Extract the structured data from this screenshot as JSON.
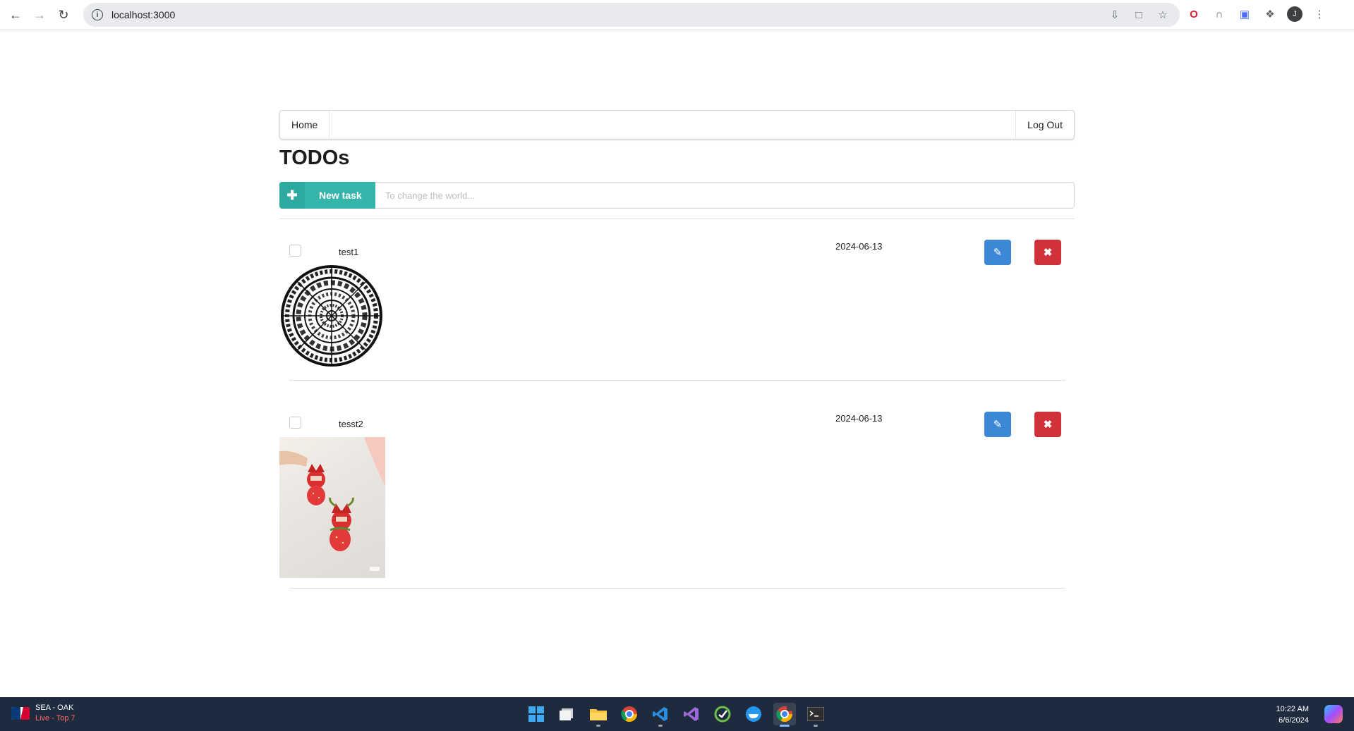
{
  "browser": {
    "url": "localhost:3000",
    "profile_initial": "J"
  },
  "nav": {
    "home": "Home",
    "logout": "Log Out"
  },
  "page": {
    "title": "TODOs"
  },
  "add_task": {
    "button_label": "New task",
    "placeholder": "To change the world..."
  },
  "todos": [
    {
      "title": "test1",
      "date": "2024-06-13",
      "done": false,
      "image": "mandala"
    },
    {
      "title": "tesst2",
      "date": "2024-06-13",
      "done": false,
      "image": "strawberry-keychains-photo"
    }
  ],
  "taskbar": {
    "score_teams": "SEA - OAK",
    "score_status": "Live - Top 7",
    "time": "10:22 AM",
    "date": "6/6/2024"
  },
  "colors": {
    "teal": "#35b5aa",
    "edit_blue": "#3c87d6",
    "delete_red": "#d0323a"
  }
}
